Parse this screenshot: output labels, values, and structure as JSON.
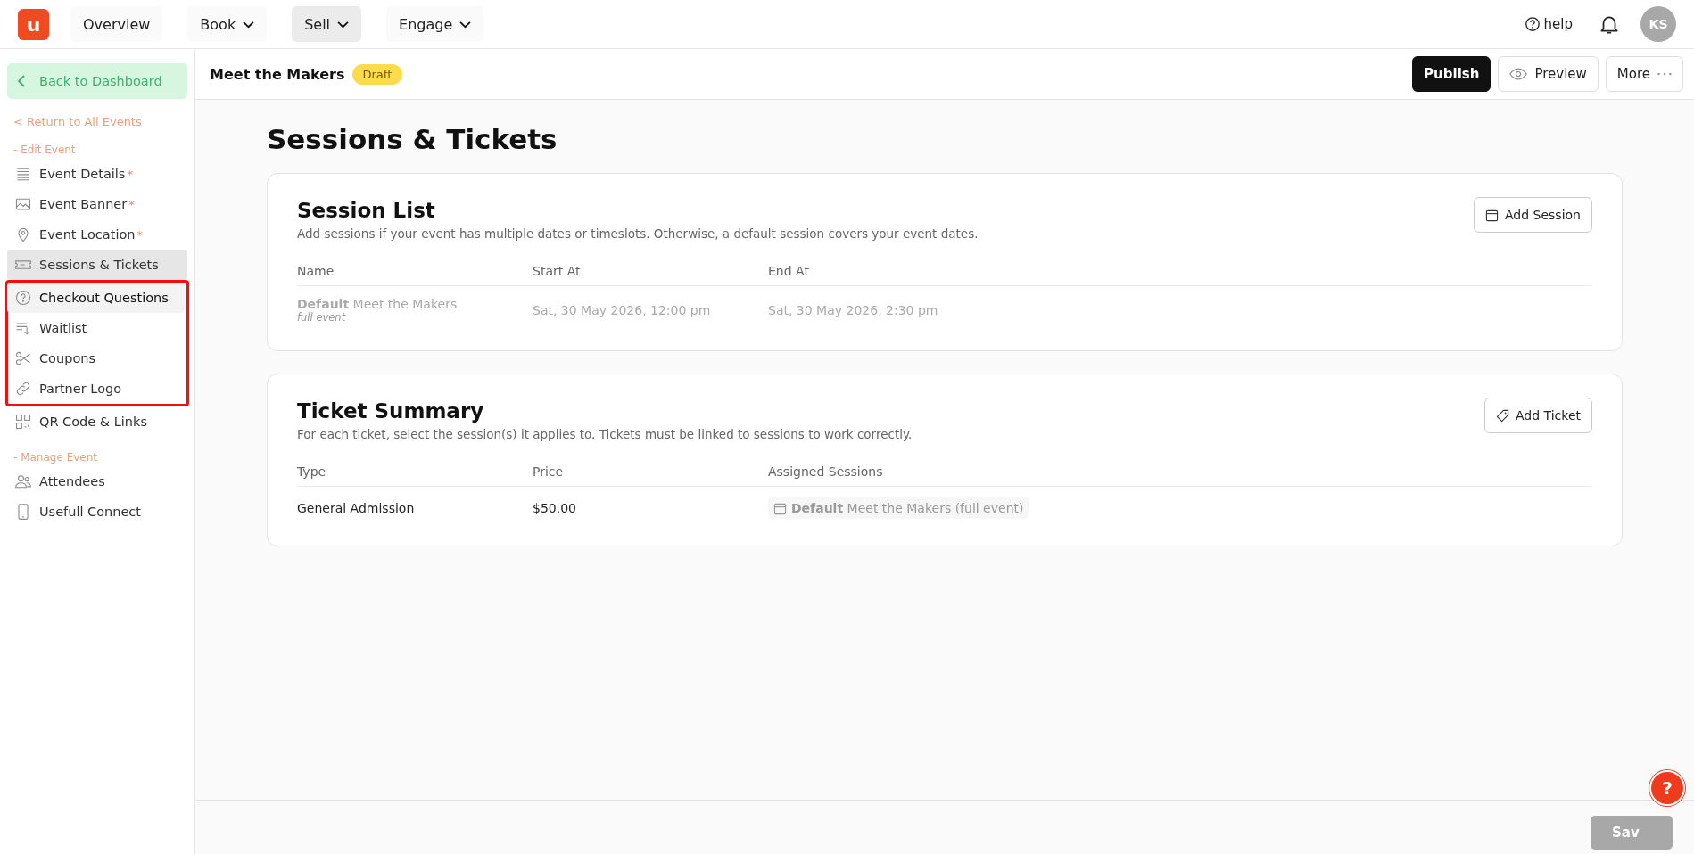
{
  "topbar": {
    "logo": "u",
    "nav": [
      {
        "label": "Overview",
        "dropdown": false,
        "selected": false
      },
      {
        "label": "Book",
        "dropdown": true,
        "selected": false
      },
      {
        "label": "Sell",
        "dropdown": true,
        "selected": true
      },
      {
        "label": "Engage",
        "dropdown": true,
        "selected": false
      }
    ],
    "help": "help",
    "avatar": "KS"
  },
  "sidebar": {
    "back_button": "Back to Dashboard",
    "return_link": "< Return to All Events",
    "groups": [
      {
        "label": "- Edit Event",
        "items": [
          {
            "label": "Event Details",
            "required_mark": "*",
            "selected": false,
            "hovered": false,
            "highlighted": false
          },
          {
            "label": "Event Banner",
            "required_mark": "*",
            "selected": false,
            "hovered": false,
            "highlighted": false
          },
          {
            "label": "Event Location",
            "required_mark": "*",
            "selected": false,
            "hovered": false,
            "highlighted": false
          },
          {
            "label": "Sessions & Tickets",
            "selected": true,
            "hovered": false,
            "highlighted": false
          },
          {
            "label": "Checkout Questions",
            "selected": false,
            "hovered": true,
            "highlighted": true
          },
          {
            "label": "Waitlist",
            "selected": false,
            "hovered": false,
            "highlighted": true
          },
          {
            "label": "Coupons",
            "selected": false,
            "hovered": false,
            "highlighted": true
          },
          {
            "label": "Partner Logo",
            "selected": false,
            "hovered": false,
            "highlighted": true
          },
          {
            "label": "QR Code & Links",
            "selected": false,
            "hovered": false,
            "highlighted": false
          }
        ]
      },
      {
        "label": "- Manage Event",
        "items": [
          {
            "label": "Attendees",
            "selected": false,
            "hovered": false,
            "highlighted": false
          },
          {
            "label": "Usefull Connect",
            "selected": false,
            "hovered": false,
            "highlighted": false
          }
        ]
      }
    ]
  },
  "header": {
    "title": "Meet the Makers",
    "status": "Draft",
    "buttons": [
      {
        "label": "Publish",
        "kind": "primary"
      },
      {
        "label": "Preview",
        "kind": "preview"
      },
      {
        "label": "More",
        "kind": "more"
      }
    ]
  },
  "page_title": "Sessions & Tickets",
  "cards": [
    {
      "kind": "sessions",
      "title": "Session List",
      "description": "Add sessions if your event has multiple dates or timeslots. Otherwise, a default session covers your event dates.",
      "button": "Add Session",
      "columns": [
        "Name",
        "Start At",
        "End At"
      ],
      "rows": [
        {
          "cells": [
            "**Default** Meet the Makers",
            "Sat, 30 May 2026, 12:00 pm",
            "Sat, 30 May 2026, 2:30 pm"
          ],
          "note": "full event",
          "muted": true
        }
      ]
    },
    {
      "kind": "tickets",
      "title": "Ticket Summary",
      "description": "For each ticket, select the session(s) it applies to. Tickets must be linked to sessions to work correctly.",
      "button": "Add Ticket",
      "columns": [
        "Type",
        "Price",
        "Assigned Sessions"
      ],
      "rows": [
        {
          "cells": [
            "General Admission",
            "$50.00"
          ],
          "chip": "**Default** Meet the Makers (full event)",
          "muted": false
        }
      ]
    }
  ],
  "footer": {
    "save_button": "Sav",
    "save_disabled": true,
    "help_button": "?"
  }
}
